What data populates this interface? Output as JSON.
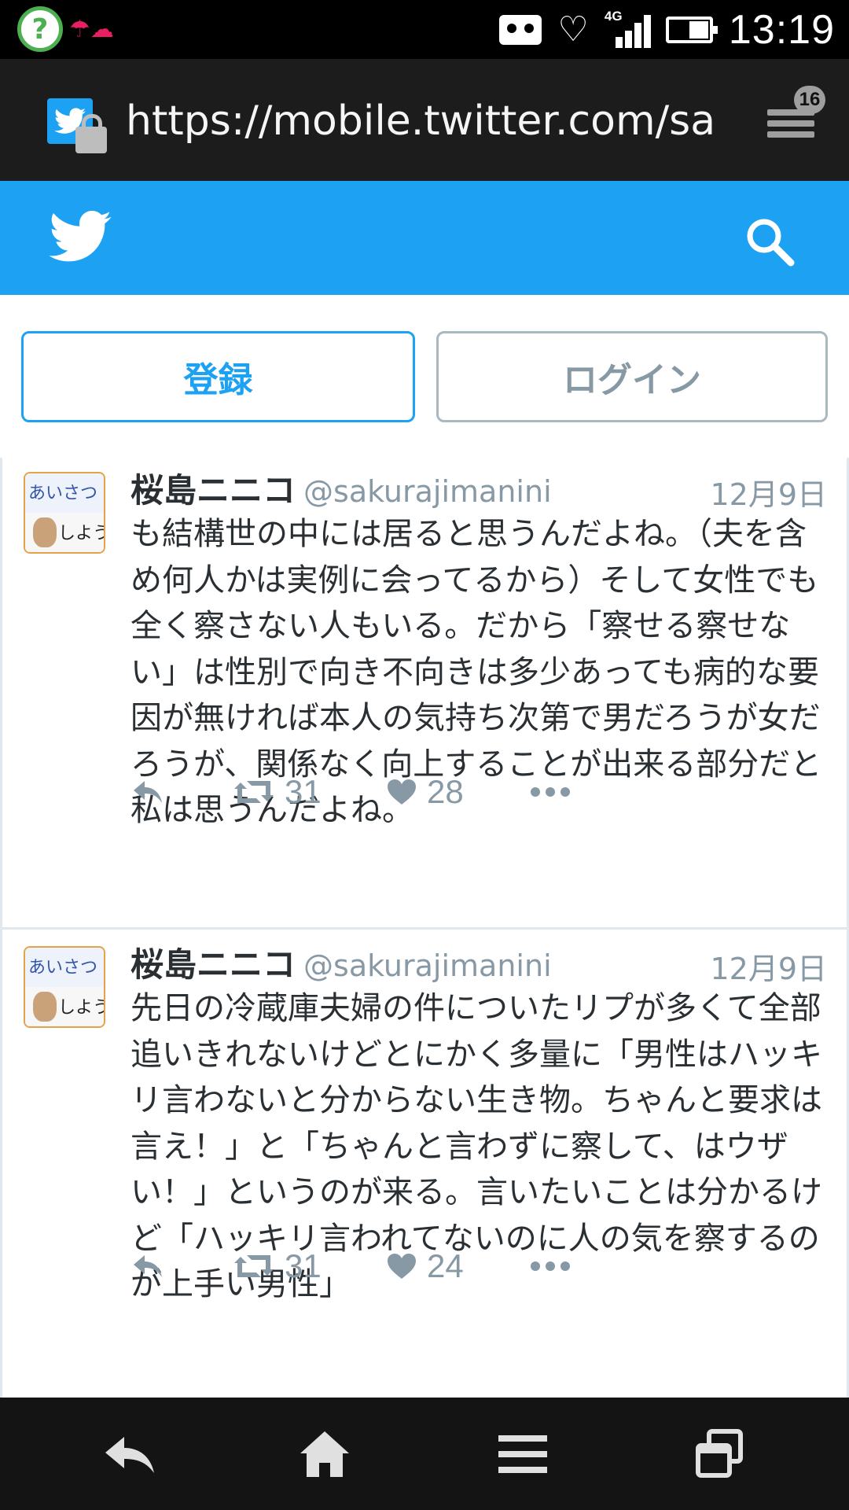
{
  "status_bar": {
    "time": "13:19",
    "network": "4G",
    "battery_level": 0.45,
    "icons": [
      "help-icon",
      "weather-icon",
      "vr-icon",
      "heart-icon",
      "signal-icon",
      "battery-icon"
    ]
  },
  "browser": {
    "url": "https://mobile.twitter.com/sakurajimanini",
    "tab_count": "16",
    "icons": [
      "twitter-site-icon",
      "lock-icon",
      "tabs-icon"
    ]
  },
  "header": {
    "brand_color": "#1da1f2",
    "icons": [
      "twitter-bird-icon",
      "search-icon"
    ]
  },
  "auth": {
    "signup_label": "登録",
    "login_label": "ログイン"
  },
  "tweets": [
    {
      "name": "桜島ニニコ",
      "handle": "@sakurajimanini",
      "time": "12月9日",
      "avatar_text_top": "あいさつ",
      "avatar_text_bottom": "しよう",
      "text": "も結構世の中には居ると思うんだよね。（夫を含め何人かは実例に会ってるから）そして女性でも全く察さない人もいる。だから「察せる察せない」は性別で向き不向きは多少あっても病的な要因が無ければ本人の気持ち次第で男だろうが女だろうが、関係なく向上することが出来る部分だと私は思うんだよね。",
      "retweets": "31",
      "likes": "28"
    },
    {
      "name": "桜島ニニコ",
      "handle": "@sakurajimanini",
      "time": "12月9日",
      "avatar_text_top": "あいさつ",
      "avatar_text_bottom": "しよう",
      "text": "先日の冷蔵庫夫婦の件についたリプが多くて全部追いきれないけどとにかく多量に「男性はハッキリ言わないと分からない生き物。ちゃんと要求は言え！」と「ちゃんと言わずに察して、はウザい！」というのが来る。言いたいことは分かるけど「ハッキリ言われてないのに人の気を察するのが上手い男性」",
      "retweets": "31",
      "likes": "24"
    }
  ],
  "bottom_nav": {
    "icons": [
      "back-icon",
      "home-icon",
      "menu-icon",
      "windows-icon"
    ]
  }
}
